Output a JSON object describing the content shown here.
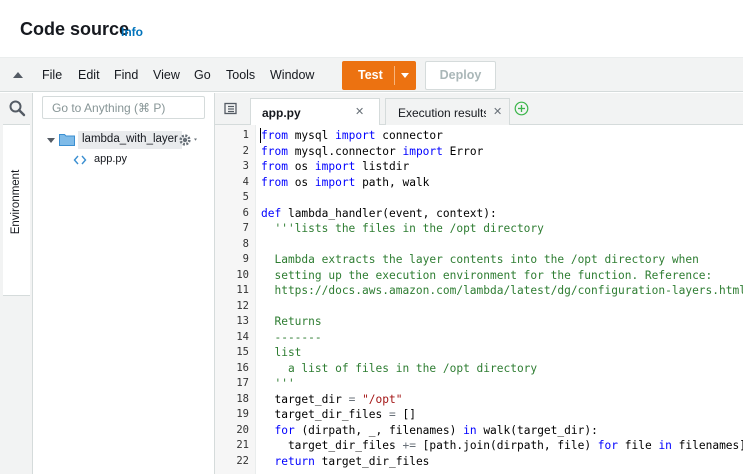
{
  "header": {
    "title": "Code source",
    "info_link": "Info"
  },
  "menubar": {
    "items": [
      "File",
      "Edit",
      "Find",
      "View",
      "Go",
      "Tools",
      "Window"
    ],
    "test_label": "Test",
    "deploy_label": "Deploy"
  },
  "sidebar": {
    "environment_tab": "Environment",
    "goto_placeholder": "Go to Anything (⌘ P)",
    "folder": "lambda_with_layer",
    "file": "app.py"
  },
  "tabs": [
    {
      "label": "app.py",
      "active": true
    },
    {
      "label": "Execution results",
      "active": false
    }
  ],
  "editor": {
    "lines": [
      "from mysql import connector",
      "from mysql.connector import Error",
      "from os import listdir",
      "from os import path, walk",
      "",
      "def lambda_handler(event, context):",
      "  '''lists the files in the /opt directory",
      "",
      "  Lambda extracts the layer contents into the /opt directory when",
      "  setting up the execution environment for the function. Reference:",
      "  https://docs.aws.amazon.com/lambda/latest/dg/configuration-layers.html",
      "",
      "  Returns",
      "  -------",
      "  list",
      "    a list of files in the /opt directory",
      "  '''",
      "  target_dir = \"/opt\"",
      "  target_dir_files = []",
      "  for (dirpath, _, filenames) in walk(target_dir):",
      "    target_dir_files += [path.join(dirpath, file) for file in filenames]",
      "  return target_dir_files"
    ]
  },
  "colors": {
    "accent": "#ec7211",
    "link": "#0073bb",
    "keyword": "#0000ff",
    "docstring": "#2e7d32"
  }
}
